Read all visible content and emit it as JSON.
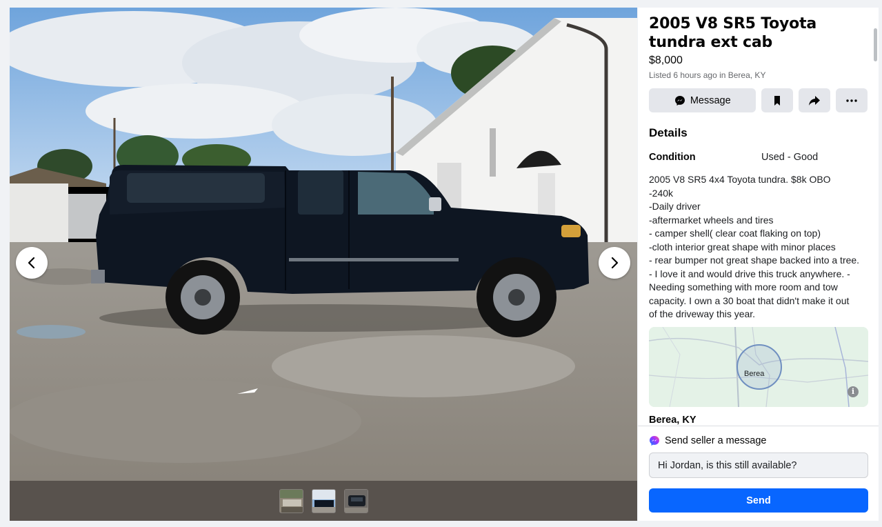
{
  "listing": {
    "title": "2005 V8 SR5 Toyota tundra ext cab",
    "price": "$8,000",
    "listed": "Listed 6 hours ago in Berea, KY"
  },
  "actions": {
    "message_label": "Message",
    "save_icon": "bookmark-icon",
    "share_icon": "share-icon",
    "more_icon": "more-icon"
  },
  "details": {
    "heading": "Details",
    "condition_label": "Condition",
    "condition_value": "Used - Good",
    "description": "2005 V8 SR5 4x4 Toyota tundra. $8k OBO\n-240k\n-Daily driver\n-aftermarket wheels and tires\n- camper shell( clear coat flaking on top)\n-cloth interior great shape with minor places\n- rear bumper not great shape backed into a tree.\n- I love it and would drive this truck anywhere. -\nNeeding something with more room and tow\ncapacity. I own a 30 boat that didn't make it out\nof the driveway this year."
  },
  "map": {
    "label": "Berea",
    "info_glyph": "i"
  },
  "location": "Berea, KY",
  "composer": {
    "heading": "Send seller a message",
    "message_value": "Hi Jordan, is this still available?",
    "send_label": "Send"
  },
  "media": {
    "thumbnails": [
      "photo-1",
      "photo-2",
      "photo-3"
    ]
  },
  "colors": {
    "accent": "#0866ff",
    "truck": "#0e1622",
    "button_bg": "#e4e6eb"
  }
}
